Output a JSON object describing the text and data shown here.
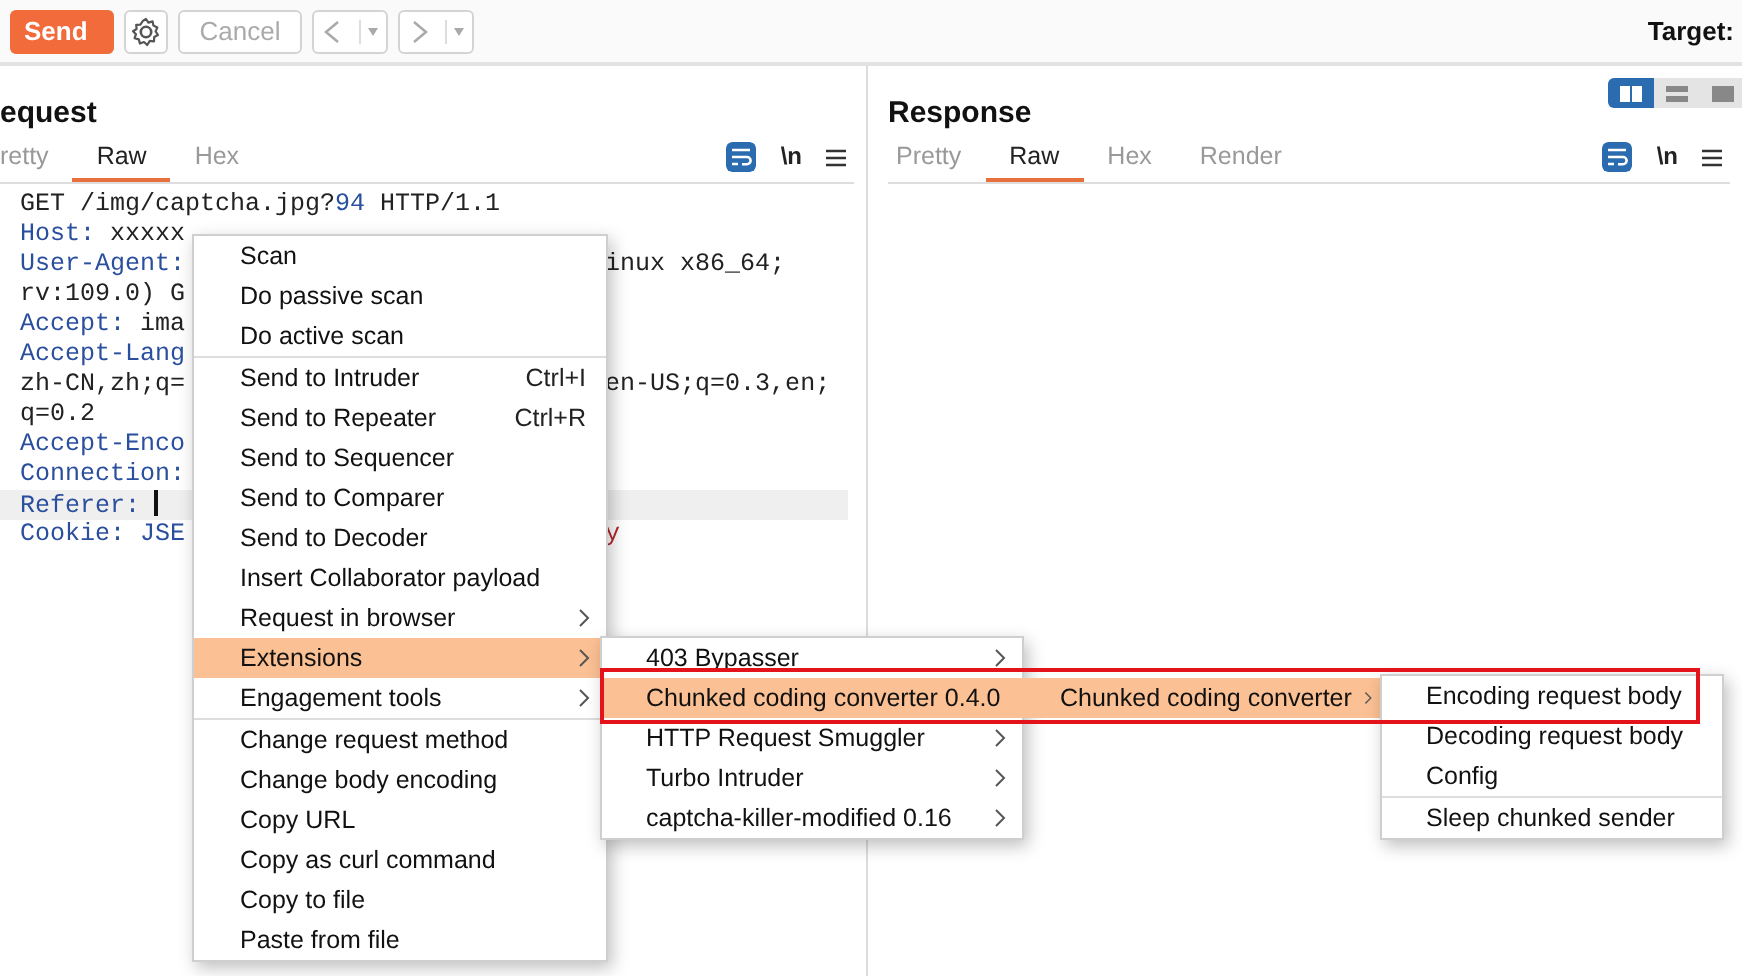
{
  "toolbar": {
    "buttons": [
      {
        "kind": "send",
        "label": "Send",
        "disabled": false
      },
      {
        "kind": "settings",
        "disabled": false
      },
      {
        "kind": "cancel",
        "label": "Cancel",
        "disabled": true
      },
      {
        "kind": "back",
        "disabled": true
      },
      {
        "kind": "forward",
        "disabled": true
      }
    ],
    "target": "Target:"
  },
  "request": {
    "title": "equest",
    "tabs": [
      {
        "label": "retty",
        "selected": false
      },
      {
        "label": "Raw",
        "selected": true
      },
      {
        "label": "Hex",
        "selected": false
      }
    ],
    "tools": {
      "wrap_on": true,
      "newline_label": "\\n"
    },
    "editor": {
      "lines": [
        {
          "current": false,
          "left": [
            {
              "kind": "text",
              "text": "GET /img/captcha.jpg?"
            },
            {
              "kind": "num",
              "text": "94"
            },
            {
              "kind": "text",
              "text": " HTTP/1.1"
            }
          ]
        },
        {
          "current": false,
          "left": [
            {
              "kind": "key",
              "text": "Host:"
            },
            {
              "kind": "text",
              "text": " xxxxx"
            }
          ]
        },
        {
          "current": false,
          "left": [
            {
              "kind": "key",
              "text": "User-Agent:"
            }
          ],
          "right": [
            {
              "kind": "text",
              "text": "inux x86_64;"
            }
          ]
        },
        {
          "current": false,
          "left": [
            {
              "kind": "text",
              "text": "rv:109.0) G"
            }
          ]
        },
        {
          "current": false,
          "left": [
            {
              "kind": "key",
              "text": "Accept:"
            },
            {
              "kind": "text",
              "text": " ima"
            }
          ]
        },
        {
          "current": false,
          "left": [
            {
              "kind": "key",
              "text": "Accept-Lang"
            }
          ]
        },
        {
          "current": false,
          "left": [
            {
              "kind": "text",
              "text": "zh-CN,zh;q="
            }
          ],
          "right": [
            {
              "kind": "text",
              "text": "en-US;q=0.3,en;"
            }
          ]
        },
        {
          "current": false,
          "left": [
            {
              "kind": "text",
              "text": "q=0.2"
            }
          ]
        },
        {
          "current": false,
          "left": [
            {
              "kind": "key",
              "text": "Accept-Enco"
            }
          ]
        },
        {
          "current": false,
          "left": [
            {
              "kind": "key",
              "text": "Connection:"
            }
          ]
        },
        {
          "current": true,
          "left": [
            {
              "kind": "key",
              "text": "Referer:"
            }
          ]
        },
        {
          "current": false,
          "left": [
            {
              "kind": "key",
              "text": "Cookie:"
            },
            {
              "kind": "num",
              "text": " JSE"
            }
          ],
          "right": [
            {
              "kind": "val",
              "text": "y"
            }
          ]
        }
      ]
    }
  },
  "response": {
    "title": "Response",
    "layout_buttons": [
      {
        "kind": "columns",
        "selected": true
      },
      {
        "kind": "rows",
        "selected": false
      },
      {
        "kind": "single",
        "selected": false
      }
    ],
    "tabs": [
      {
        "label": "Pretty",
        "selected": false
      },
      {
        "label": "Raw",
        "selected": true
      },
      {
        "label": "Hex",
        "selected": false
      },
      {
        "label": "Render",
        "selected": false
      }
    ],
    "tools": {
      "wrap_on": true,
      "newline_label": "\\n"
    }
  },
  "context_menu": {
    "sections": [
      [
        {
          "label": "Scan",
          "has_submenu": false,
          "selected": false
        },
        {
          "label": "Do passive scan",
          "has_submenu": false,
          "selected": false
        },
        {
          "label": "Do active scan",
          "has_submenu": false,
          "selected": false
        }
      ],
      [
        {
          "label": "Send to Intruder",
          "shortcut": "Ctrl+I",
          "has_submenu": false,
          "selected": false
        },
        {
          "label": "Send to Repeater",
          "shortcut": "Ctrl+R",
          "has_submenu": false,
          "selected": false
        },
        {
          "label": "Send to Sequencer",
          "has_submenu": false,
          "selected": false
        },
        {
          "label": "Send to Comparer",
          "has_submenu": false,
          "selected": false
        },
        {
          "label": "Send to Decoder",
          "has_submenu": false,
          "selected": false
        },
        {
          "label": "Insert Collaborator payload",
          "has_submenu": false,
          "selected": false
        },
        {
          "label": "Request in browser",
          "has_submenu": true,
          "selected": false
        },
        {
          "label": "Extensions",
          "has_submenu": true,
          "selected": true
        },
        {
          "label": "Engagement tools",
          "has_submenu": true,
          "selected": false
        }
      ],
      [
        {
          "label": "Change request method",
          "has_submenu": false,
          "selected": false
        },
        {
          "label": "Change body encoding",
          "has_submenu": false,
          "selected": false
        },
        {
          "label": "Copy URL",
          "has_submenu": false,
          "selected": false
        },
        {
          "label": "Copy as curl command",
          "has_submenu": false,
          "selected": false
        },
        {
          "label": "Copy to file",
          "has_submenu": false,
          "selected": false
        },
        {
          "label": "Paste from file",
          "has_submenu": false,
          "selected": false
        }
      ]
    ]
  },
  "extensions_menu": {
    "sections": [
      [
        {
          "label": "403 Bypasser",
          "has_submenu": true,
          "selected": false
        },
        {
          "label": "Chunked coding converter 0.4.0",
          "has_submenu": true,
          "selected": true
        },
        {
          "label": "HTTP Request Smuggler",
          "has_submenu": true,
          "selected": false
        },
        {
          "label": "Turbo Intruder",
          "has_submenu": true,
          "selected": false
        },
        {
          "label": "captcha-killer-modified 0.16",
          "has_submenu": true,
          "selected": false
        }
      ]
    ]
  },
  "converter_menu": {
    "sections": [
      [
        {
          "label": "Chunked coding converter",
          "has_submenu": true,
          "selected": true
        }
      ]
    ]
  },
  "action_menu": {
    "sections": [
      [
        {
          "label": "Encoding request body",
          "has_submenu": false,
          "selected": false
        },
        {
          "label": "Decoding request body",
          "has_submenu": false,
          "selected": false
        },
        {
          "label": "Config",
          "has_submenu": false,
          "selected": false
        }
      ],
      [
        {
          "label": "Sleep chunked sender",
          "has_submenu": false,
          "selected": false
        }
      ]
    ]
  }
}
